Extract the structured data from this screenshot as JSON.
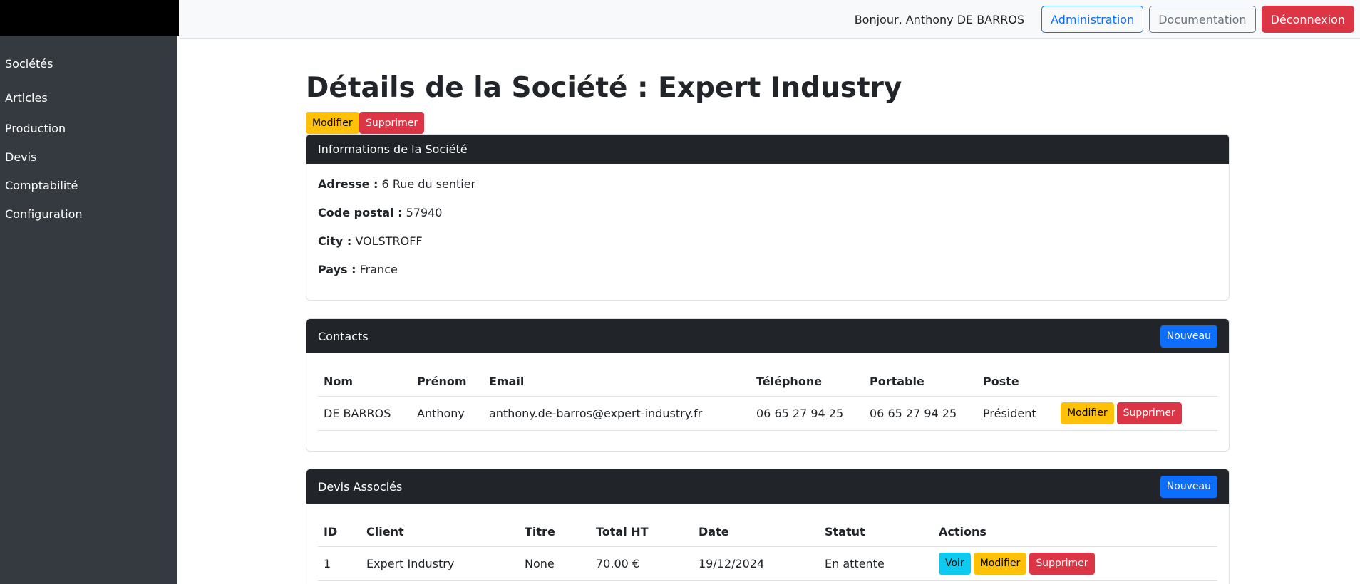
{
  "header": {
    "greeting": "Bonjour, Anthony DE BARROS",
    "admin_label": "Administration",
    "doc_label": "Documentation",
    "logout_label": "Déconnexion"
  },
  "sidebar": {
    "items": [
      {
        "label": "Sociétés"
      },
      {
        "label": "Articles"
      },
      {
        "label": "Production"
      },
      {
        "label": "Devis"
      },
      {
        "label": "Comptabilité"
      },
      {
        "label": "Configuration"
      }
    ]
  },
  "page": {
    "title": "Détails de la Société : Expert Industry",
    "edit_label": "Modifier",
    "delete_label": "Supprimer"
  },
  "info": {
    "header": "Informations de la Société",
    "address_label": "Adresse :",
    "address": "6 Rue du sentier",
    "postal_label": "Code postal :",
    "postal": "57940",
    "city_label": "City :",
    "city": "VOLSTROFF",
    "country_label": "Pays :",
    "country": "France"
  },
  "contacts": {
    "header": "Contacts",
    "new_label": "Nouveau",
    "columns": [
      "Nom",
      "Prénom",
      "Email",
      "Téléphone",
      "Portable",
      "Poste"
    ],
    "rows": [
      {
        "nom": "DE BARROS",
        "prenom": "Anthony",
        "email": "anthony.de-barros@expert-industry.fr",
        "telephone": "06 65 27 94 25",
        "portable": "06 65 27 94 25",
        "poste": "Président",
        "edit_label": "Modifier",
        "delete_label": "Supprimer"
      }
    ]
  },
  "devis": {
    "header": "Devis Associés",
    "new_label": "Nouveau",
    "columns": [
      "ID",
      "Client",
      "Titre",
      "Total HT",
      "Date",
      "Statut",
      "Actions"
    ],
    "rows": [
      {
        "id": "1",
        "client": "Expert Industry",
        "titre": "None",
        "total": "70.00 €",
        "date": "19/12/2024",
        "statut": "En attente",
        "view_label": "Voir",
        "edit_label": "Modifier",
        "delete_label": "Supprimer"
      }
    ]
  },
  "colors": {
    "primary": "#0d6efd",
    "warning": "#ffc107",
    "danger": "#dc3545",
    "info": "#0dcaf0",
    "dark": "#212529",
    "sidebar": "#343a40"
  }
}
